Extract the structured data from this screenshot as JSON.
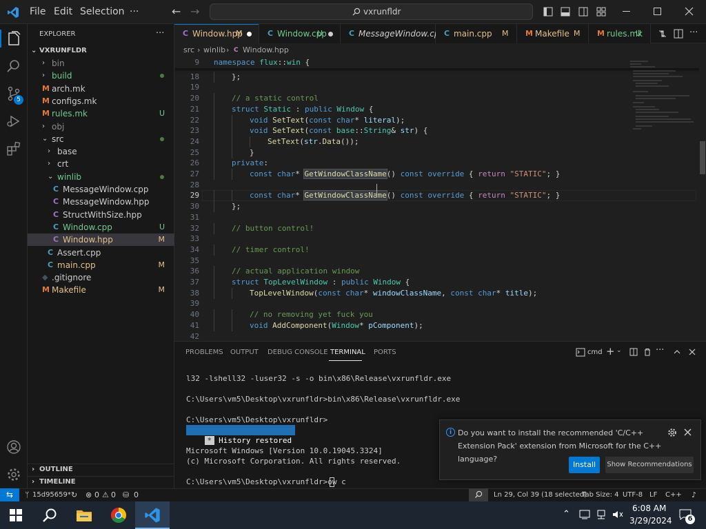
{
  "titlebar": {
    "menu": [
      "File",
      "Edit",
      "Selection"
    ],
    "overflow": "···",
    "search": "vxrunfldr"
  },
  "activity": {
    "scm_badge": "5"
  },
  "sidebar": {
    "title": "EXPLORER",
    "root": "VXRUNFLDR",
    "items": [
      {
        "label": "bin",
        "kind": "folder",
        "depth": 1,
        "open": false,
        "color": "#8c8c8c",
        "status": ""
      },
      {
        "label": "build",
        "kind": "folder",
        "depth": 1,
        "open": false,
        "color": "#73c991",
        "status": "dot"
      },
      {
        "label": "arch.mk",
        "kind": "mk",
        "depth": 1,
        "color": "#cccccc",
        "status": ""
      },
      {
        "label": "configs.mk",
        "kind": "mk",
        "depth": 1,
        "color": "#cccccc",
        "status": ""
      },
      {
        "label": "rules.mk",
        "kind": "mk",
        "depth": 1,
        "color": "#73c991",
        "status": "U"
      },
      {
        "label": "obj",
        "kind": "folder",
        "depth": 1,
        "open": false,
        "color": "#8c8c8c",
        "status": ""
      },
      {
        "label": "src",
        "kind": "folder",
        "depth": 1,
        "open": true,
        "color": "#cccccc",
        "status": "dot"
      },
      {
        "label": "base",
        "kind": "folder",
        "depth": 2,
        "open": false,
        "color": "#cccccc",
        "status": ""
      },
      {
        "label": "crt",
        "kind": "folder",
        "depth": 2,
        "open": false,
        "color": "#cccccc",
        "status": ""
      },
      {
        "label": "winlib",
        "kind": "folder",
        "depth": 2,
        "open": true,
        "color": "#73c991",
        "status": "dot"
      },
      {
        "label": "MessageWindow.cpp",
        "kind": "cpp",
        "depth": 3,
        "color": "#cccccc",
        "status": ""
      },
      {
        "label": "MessageWindow.hpp",
        "kind": "hpp",
        "depth": 3,
        "color": "#cccccc",
        "status": ""
      },
      {
        "label": "StructWithSize.hpp",
        "kind": "hpp",
        "depth": 3,
        "color": "#cccccc",
        "status": ""
      },
      {
        "label": "Window.cpp",
        "kind": "cpp",
        "depth": 3,
        "color": "#73c991",
        "status": "U"
      },
      {
        "label": "Window.hpp",
        "kind": "hpp",
        "depth": 3,
        "color": "#e2c08d",
        "status": "M",
        "selected": true
      },
      {
        "label": "Assert.cpp",
        "kind": "cpp",
        "depth": 2,
        "color": "#cccccc",
        "status": ""
      },
      {
        "label": "main.cpp",
        "kind": "cpp",
        "depth": 2,
        "color": "#e2c08d",
        "status": "M"
      },
      {
        "label": ".gitignore",
        "kind": "git",
        "depth": 1,
        "color": "#cccccc",
        "status": ""
      },
      {
        "label": "Makefile",
        "kind": "mk",
        "depth": 1,
        "color": "#e2c08d",
        "status": "M"
      }
    ],
    "outline": "OUTLINE",
    "timeline": "TIMELINE"
  },
  "tabs": [
    {
      "label": "Window.hpp",
      "status": "M",
      "dirty": true,
      "active": true,
      "kind": "hpp",
      "color": "#e2c08d",
      "italic": false
    },
    {
      "label": "Window.cpp",
      "status": "U",
      "dirty": true,
      "active": false,
      "kind": "cpp",
      "color": "#73c991",
      "italic": false
    },
    {
      "label": "MessageWindow.cpp",
      "status": "",
      "dirty": false,
      "active": false,
      "kind": "cpp",
      "color": "#cccccc",
      "italic": true
    },
    {
      "label": "main.cpp",
      "status": "M",
      "dirty": false,
      "active": false,
      "kind": "cpp",
      "color": "#e2c08d",
      "italic": false
    },
    {
      "label": "Makefile",
      "status": "M",
      "dirty": false,
      "active": false,
      "kind": "mk",
      "color": "#e2c08d",
      "italic": false
    },
    {
      "label": "rules.mk",
      "status": "U",
      "dirty": false,
      "active": false,
      "kind": "mk",
      "color": "#73c991",
      "italic": false
    }
  ],
  "breadcrumb": [
    "src",
    "winlib",
    "Window.hpp"
  ],
  "sticky": {
    "num": "9",
    "code": [
      [
        "kw",
        "namespace "
      ],
      [
        "ty",
        "flux"
      ],
      [
        "pu",
        "::"
      ],
      [
        "ty",
        "win"
      ],
      [
        "pu",
        " {"
      ]
    ]
  },
  "code": [
    {
      "n": "18",
      "indent": 1,
      "t": [
        [
          "pu",
          "};"
        ]
      ]
    },
    {
      "n": "19",
      "indent": 0,
      "t": []
    },
    {
      "n": "20",
      "indent": 1,
      "t": [
        [
          "cm",
          "// a static control"
        ]
      ]
    },
    {
      "n": "21",
      "indent": 1,
      "t": [
        [
          "kw",
          "struct "
        ],
        [
          "ty",
          "Static"
        ],
        [
          "pu",
          " : "
        ],
        [
          "kw",
          "public "
        ],
        [
          "ty",
          "Window"
        ],
        [
          "pu",
          " {"
        ]
      ]
    },
    {
      "n": "22",
      "indent": 2,
      "t": [
        [
          "kw",
          "void "
        ],
        [
          "fn",
          "SetText"
        ],
        [
          "pu",
          "("
        ],
        [
          "kw",
          "const char"
        ],
        [
          "pu",
          "* "
        ],
        [
          "va",
          "literal"
        ],
        [
          "pu",
          ");"
        ]
      ]
    },
    {
      "n": "23",
      "indent": 2,
      "t": [
        [
          "kw",
          "void "
        ],
        [
          "fn",
          "SetText"
        ],
        [
          "pu",
          "("
        ],
        [
          "kw",
          "const "
        ],
        [
          "ty",
          "base"
        ],
        [
          "pu",
          "::"
        ],
        [
          "ty",
          "String"
        ],
        [
          "pu",
          "& "
        ],
        [
          "va",
          "str"
        ],
        [
          "pu",
          ") {"
        ]
      ]
    },
    {
      "n": "24",
      "indent": 3,
      "t": [
        [
          "fn",
          "SetText"
        ],
        [
          "pu",
          "("
        ],
        [
          "va",
          "str"
        ],
        [
          "pu",
          "."
        ],
        [
          "fn",
          "Data"
        ],
        [
          "pu",
          "());"
        ]
      ]
    },
    {
      "n": "25",
      "indent": 2,
      "t": [
        [
          "pu",
          "}"
        ]
      ]
    },
    {
      "n": "26",
      "indent": 1,
      "t": [
        [
          "kw",
          "private"
        ],
        [
          "pu",
          ":"
        ]
      ]
    },
    {
      "n": "27",
      "indent": 2,
      "t": [
        [
          "kw",
          "const char"
        ],
        [
          "pu",
          "* "
        ],
        [
          "fn hl",
          "GetWindowClassName"
        ],
        [
          "pu",
          "() "
        ],
        [
          "kw",
          "const "
        ],
        [
          "kw",
          "override"
        ],
        [
          "pu",
          " { "
        ],
        [
          "ctl",
          "return "
        ],
        [
          "st2",
          "\"STATIC\""
        ],
        [
          "pu",
          "; }"
        ]
      ]
    },
    {
      "n": "28",
      "indent": 0,
      "t": []
    },
    {
      "n": "29",
      "indent": 2,
      "t": [
        [
          "kw",
          "const char"
        ],
        [
          "pu",
          "* "
        ],
        [
          "fn hl",
          "GetWindowClassName"
        ],
        [
          "pu",
          "() "
        ],
        [
          "kw",
          "const "
        ],
        [
          "kw",
          "override"
        ],
        [
          "pu",
          " { "
        ],
        [
          "ctl",
          "return "
        ],
        [
          "st2",
          "\"STATIC\""
        ],
        [
          "pu",
          "; }"
        ]
      ],
      "current": true
    },
    {
      "n": "30",
      "indent": 1,
      "t": [
        [
          "pu",
          "};"
        ]
      ]
    },
    {
      "n": "31",
      "indent": 0,
      "t": []
    },
    {
      "n": "32",
      "indent": 1,
      "t": [
        [
          "cm",
          "// button control!"
        ]
      ]
    },
    {
      "n": "33",
      "indent": 0,
      "t": []
    },
    {
      "n": "34",
      "indent": 1,
      "t": [
        [
          "cm",
          "// timer control!"
        ]
      ]
    },
    {
      "n": "35",
      "indent": 0,
      "t": []
    },
    {
      "n": "36",
      "indent": 1,
      "t": [
        [
          "cm",
          "// actual application window"
        ]
      ]
    },
    {
      "n": "37",
      "indent": 1,
      "t": [
        [
          "kw",
          "struct "
        ],
        [
          "ty",
          "TopLevelWindow"
        ],
        [
          "pu",
          " : "
        ],
        [
          "kw",
          "public "
        ],
        [
          "ty",
          "Window"
        ],
        [
          "pu",
          " {"
        ]
      ]
    },
    {
      "n": "38",
      "indent": 2,
      "t": [
        [
          "fn",
          "TopLevelWindow"
        ],
        [
          "pu",
          "("
        ],
        [
          "kw",
          "const char"
        ],
        [
          "pu",
          "* "
        ],
        [
          "va",
          "windowClassName"
        ],
        [
          "pu",
          ", "
        ],
        [
          "kw",
          "const char"
        ],
        [
          "pu",
          "* "
        ],
        [
          "va",
          "title"
        ],
        [
          "pu",
          ");"
        ]
      ]
    },
    {
      "n": "39",
      "indent": 0,
      "t": []
    },
    {
      "n": "40",
      "indent": 2,
      "t": [
        [
          "cm",
          "// no removing yet fuck you"
        ]
      ]
    },
    {
      "n": "41",
      "indent": 2,
      "t": [
        [
          "kw",
          "void "
        ],
        [
          "fn",
          "AddComponent"
        ],
        [
          "pu",
          "("
        ],
        [
          "ty",
          "Window"
        ],
        [
          "pu",
          "* "
        ],
        [
          "va",
          "pComponent"
        ],
        [
          "pu",
          ");"
        ]
      ]
    },
    {
      "n": "42",
      "indent": 0,
      "t": []
    }
  ],
  "panel": {
    "tabs": [
      "PROBLEMS",
      "OUTPUT",
      "DEBUG CONSOLE",
      "TERMINAL",
      "PORTS"
    ],
    "active_tab": "TERMINAL",
    "shell": "cmd",
    "terminal": [
      "l32 -lshell32 -luser32 -s -o bin\\x86\\Release\\vxrunfldr.exe",
      "",
      "C:\\Users\\vm5\\Desktop\\vxrunfldr>bin\\x86\\Release\\vxrunfldr.exe",
      "",
      "C:\\Users\\vm5\\Desktop\\vxrunfldr>",
      "",
      "",
      "Microsoft Windows [Version 10.0.19045.3324]",
      "(c) Microsoft Corporation. All rights reserved.",
      "",
      "C:\\Users\\vm5\\Desktop\\vxrunfldr>ow c"
    ],
    "history_star": "*",
    "history_label": "History restored"
  },
  "notification": {
    "message": "Do you want to install the recommended 'C/C++ Extension Pack' extension from Microsoft for the C++ language?",
    "install": "Install",
    "recommend": "Show Recommendations"
  },
  "statusbar": {
    "branch": "15d95659*",
    "errors": "0",
    "warnings": "0",
    "ports": "0",
    "position": "Ln 29, Col 39 (18 selected)",
    "tab_size": "Tab Size: 4",
    "encoding": "UTF-8",
    "eol": "LF",
    "language": "C++"
  },
  "taskbar": {
    "time": "6:08 AM",
    "date": "3/29/2024",
    "notif_count": "6"
  },
  "colors": {
    "accent": "#0078d4",
    "modified": "#e2c08d",
    "untracked": "#73c991"
  }
}
